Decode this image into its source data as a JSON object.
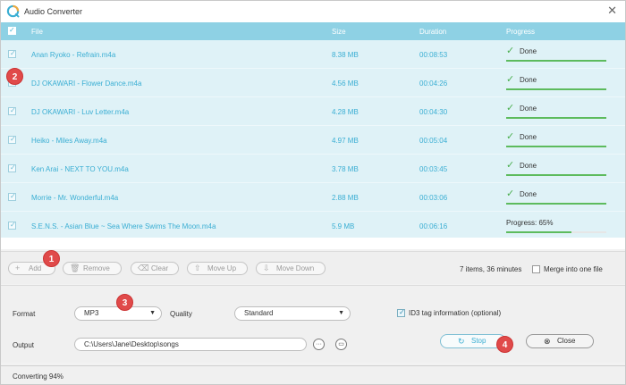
{
  "window": {
    "title": "Audio Converter",
    "close_glyph": "✕"
  },
  "table": {
    "headers": {
      "file": "File",
      "size": "Size",
      "duration": "Duration",
      "progress": "Progress"
    },
    "rows": [
      {
        "file": "Anan Ryoko - Refrain.m4a",
        "size": "8.38 MB",
        "duration": "00:08:53",
        "status": "Done",
        "progress": 1.0
      },
      {
        "file": "DJ OKAWARI - Flower Dance.m4a",
        "size": "4.56 MB",
        "duration": "00:04:26",
        "status": "Done",
        "progress": 1.0
      },
      {
        "file": "DJ OKAWARI - Luv Letter.m4a",
        "size": "4.28 MB",
        "duration": "00:04:30",
        "status": "Done",
        "progress": 1.0
      },
      {
        "file": "Heiko - Miles Away.m4a",
        "size": "4.97 MB",
        "duration": "00:05:04",
        "status": "Done",
        "progress": 1.0
      },
      {
        "file": "Ken Arai - NEXT TO YOU.m4a",
        "size": "3.78 MB",
        "duration": "00:03:45",
        "status": "Done",
        "progress": 1.0
      },
      {
        "file": "Morrie - Mr. Wonderful.m4a",
        "size": "2.88 MB",
        "duration": "00:03:06",
        "status": "Done",
        "progress": 1.0
      },
      {
        "file": "S.E.N.S. - Asian Blue ~ Sea Where Swims The Moon.m4a",
        "size": "5.9 MB",
        "duration": "00:06:16",
        "status": "Progress: 65%",
        "progress": 0.65
      }
    ]
  },
  "toolbar": {
    "add": "Add",
    "remove": "Remove",
    "clear": "Clear",
    "move_up": "Move Up",
    "move_down": "Move Down",
    "items_info": "7 items, 36 minutes",
    "merge_label": "Merge into one file"
  },
  "settings": {
    "format_label": "Format",
    "format_value": "MP3",
    "quality_label": "Quality",
    "quality_value": "Standard",
    "id3_label": "ID3 tag information (optional)",
    "output_label": "Output",
    "output_path": "C:\\Users\\Jane\\Desktop\\songs",
    "stop": "Stop",
    "close": "Close"
  },
  "status": {
    "text": "Converting 94%"
  },
  "markers": [
    "1",
    "2",
    "3",
    "4"
  ],
  "colors": {
    "accent": "#3aaed3",
    "header": "#8ed1e4",
    "grid": "#dff2f7",
    "done": "#4caf50",
    "marker": "#e04a4a"
  }
}
